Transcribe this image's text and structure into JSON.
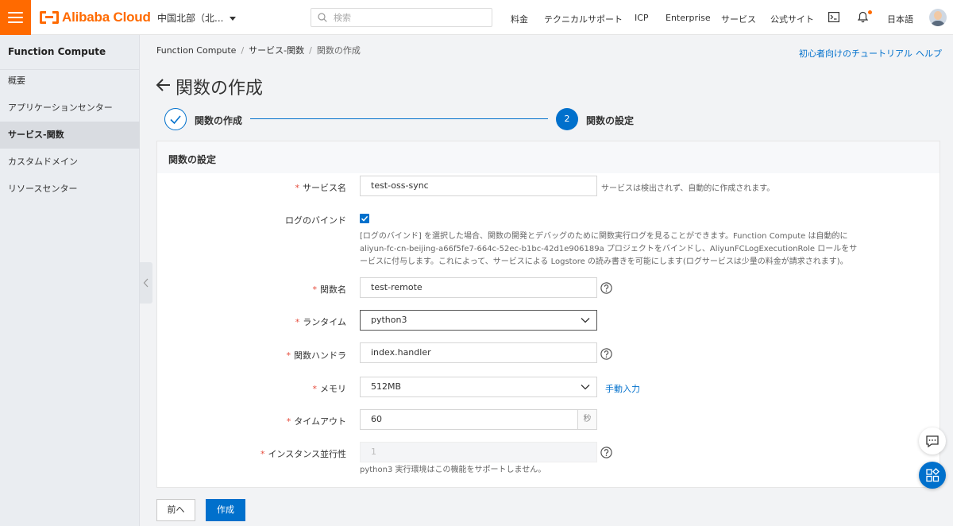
{
  "topbar": {
    "brand": "Alibaba Cloud",
    "region": "中国北部（北...",
    "search_placeholder": "検索",
    "nav": [
      "料金",
      "テクニカルサポート",
      "ICP",
      "Enterprise",
      "サービス",
      "公式サイト"
    ],
    "language": "日本語"
  },
  "sidebar": {
    "title": "Function Compute",
    "items": [
      {
        "label": "概要",
        "active": false
      },
      {
        "label": "アプリケーションセンター",
        "active": false
      },
      {
        "label": "サービス-関数",
        "active": true
      },
      {
        "label": "カスタムドメイン",
        "active": false
      },
      {
        "label": "リソースセンター",
        "active": false
      }
    ]
  },
  "breadcrumb": [
    "Function Compute",
    "サービス-関数",
    "関数の作成"
  ],
  "links": {
    "tutorial": "初心者向けのチュートリアル",
    "help": "ヘルプ"
  },
  "page_title": "関数の作成",
  "steps": [
    {
      "label": "関数の作成",
      "state": "done"
    },
    {
      "number": "2",
      "label": "関数の設定",
      "state": "current"
    }
  ],
  "form": {
    "section_title": "関数の設定",
    "service_name": {
      "label": "サービス名",
      "value": "test-oss-sync",
      "hint": "サービスは検出されず、自動的に作成されます。"
    },
    "log_bind": {
      "label": "ログのバインド",
      "checked": true,
      "desc": [
        "[ログのバインド] を選択した場合、関数の開発とデバッグのために関数実行ログを見ることができます。Function Compute は自動的に",
        "aliyun-fc-cn-beijing-a66f5fe7-664c-52ec-b1bc-42d1e906189a プロジェクトをバインドし、AliyunFCLogExecutionRole ロールをサ",
        "ービスに付与します。これによって、サービスによる Logstore の読み書きを可能にします(ログサービスは少量の料金が請求されます)。"
      ]
    },
    "function_name": {
      "label": "関数名",
      "value": "test-remote"
    },
    "runtime": {
      "label": "ランタイム",
      "value": "python3"
    },
    "handler": {
      "label": "関数ハンドラ",
      "value": "index.handler"
    },
    "memory": {
      "label": "メモリ",
      "value": "512MB",
      "manual_link": "手動入力"
    },
    "timeout": {
      "label": "タイムアウト",
      "value": "60",
      "unit": "秒"
    },
    "concurrency": {
      "label": "インスタンス並行性",
      "value": "1",
      "note": "python3 実行環境はこの機能をサポートしません。"
    }
  },
  "buttons": {
    "prev": "前へ",
    "create": "作成"
  },
  "colors": {
    "accent": "#0070cc",
    "brand": "#ff6a00",
    "required": "#e64c3c"
  }
}
